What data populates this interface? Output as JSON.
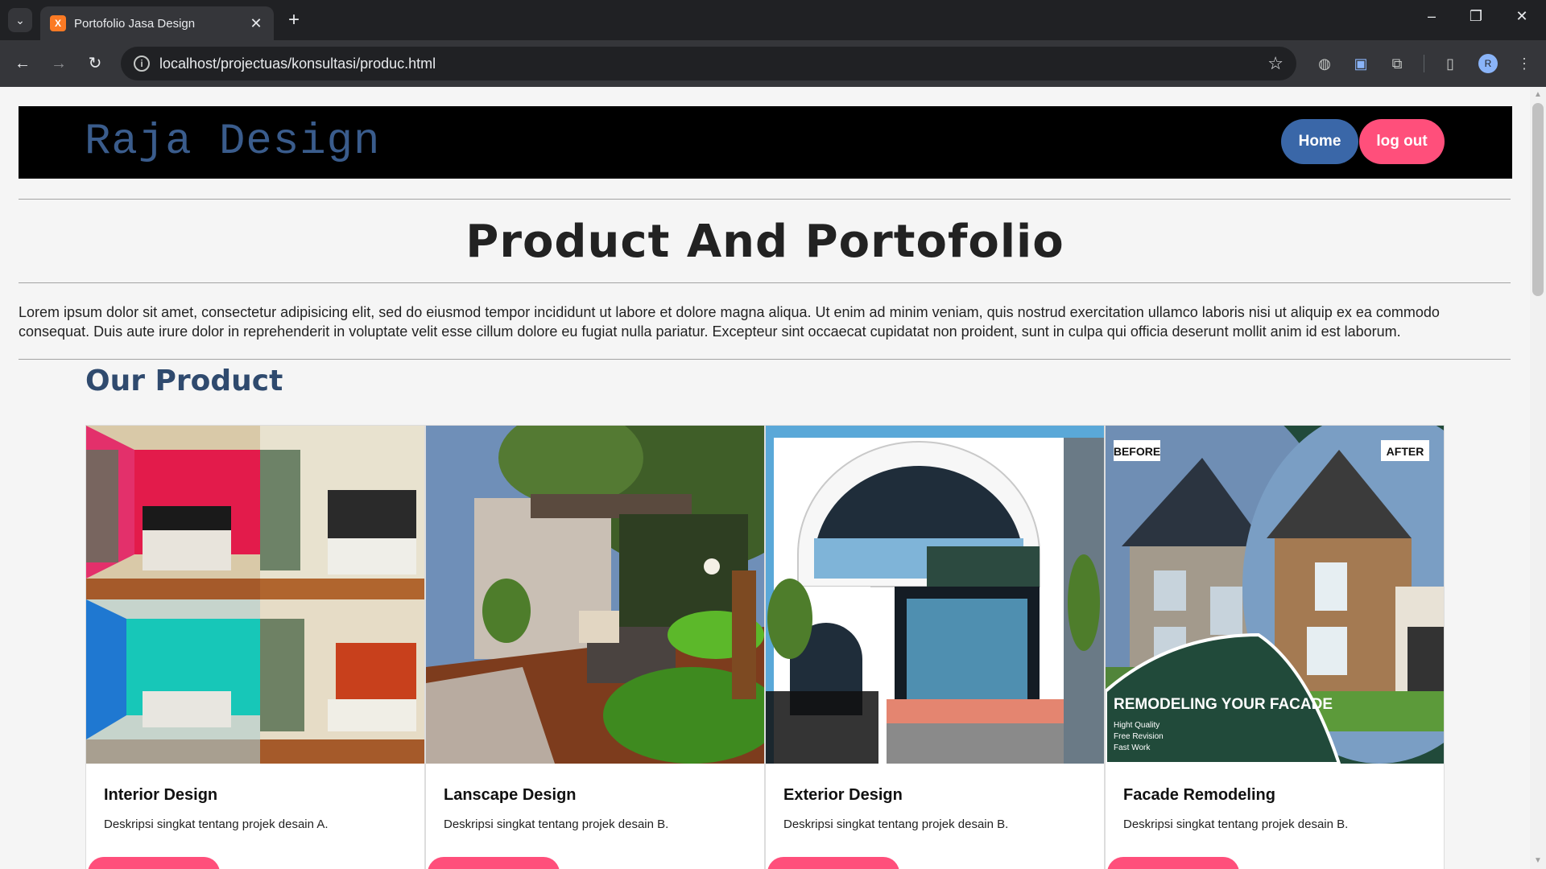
{
  "browser": {
    "tab_title": "Portofolio Jasa Design",
    "favicon_label": "X",
    "url": "localhost/projectuas/konsultasi/produc.html",
    "profile_initial": "R"
  },
  "header": {
    "logo": "Raja Design",
    "home_label": "Home",
    "logout_label": "log out"
  },
  "main": {
    "title": "Product And Portofolio",
    "intro": "Lorem ipsum dolor sit amet, consectetur adipisicing elit, sed do eiusmod tempor incididunt ut labore et dolore magna aliqua. Ut enim ad minim veniam, quis nostrud exercitation ullamco laboris nisi ut aliquip ex ea commodo consequat. Duis aute irure dolor in reprehenderit in voluptate velit esse cillum dolore eu fugiat nulla pariatur. Excepteur sint occaecat cupidatat non proident, sunt in culpa qui officia deserunt mollit anim id est laborum.",
    "section_title": "Our Product"
  },
  "products": [
    {
      "name": "Interior Design",
      "description": "Deskripsi singkat tentang projek desain A."
    },
    {
      "name": "Lanscape Design",
      "description": "Deskripsi singkat tentang projek desain B."
    },
    {
      "name": "Exterior Design",
      "description": "Deskripsi singkat tentang projek desain B."
    },
    {
      "name": "Facade Remodeling",
      "description": "Deskripsi singkat tentang projek desain B."
    }
  ],
  "facade_image": {
    "before": "BEFORE",
    "after": "AFTER",
    "headline": "REMODELING YOUR FACADE",
    "bullets": [
      "Hight Quality",
      "Free Revision",
      "Fast Work"
    ]
  },
  "colors": {
    "accent_blue": "#3a67a8",
    "accent_pink": "#ff4f7b",
    "logo_blue": "#3a5c8c",
    "section_blue": "#2f4a6e"
  }
}
